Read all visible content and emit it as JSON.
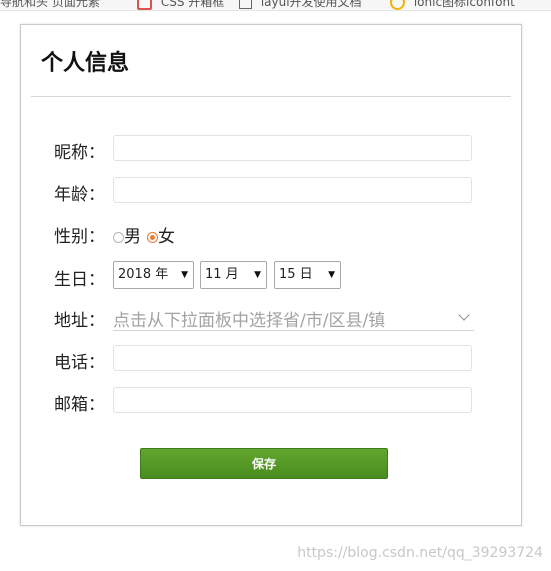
{
  "bookmarks": [
    {
      "label": "导航和头  页面元素"
    },
    {
      "label": "CSS 开箱框"
    },
    {
      "label": "layui开发使用文档"
    },
    {
      "label": "ionic图标iconfont"
    }
  ],
  "form": {
    "title": "个人信息",
    "nickname": {
      "label": "昵称：",
      "value": ""
    },
    "age": {
      "label": "年龄：",
      "value": ""
    },
    "gender": {
      "label": "性别：",
      "options": [
        "男",
        "女"
      ],
      "selected": "女"
    },
    "birthday": {
      "label": "生日：",
      "year": "2018 年",
      "month": "11 月",
      "day": "15 日"
    },
    "address": {
      "label": "地址：",
      "placeholder": "点击从下拉面板中选择省/市/区县/镇"
    },
    "phone": {
      "label": "电话：",
      "value": ""
    },
    "email": {
      "label": "邮箱：",
      "value": ""
    },
    "save_label": "保存"
  },
  "watermark": "https://blog.csdn.net/qq_39293724",
  "colors": {
    "save_button": "#55981f",
    "radio_checked": "#e57c32",
    "card_border": "#c9c9c9"
  }
}
